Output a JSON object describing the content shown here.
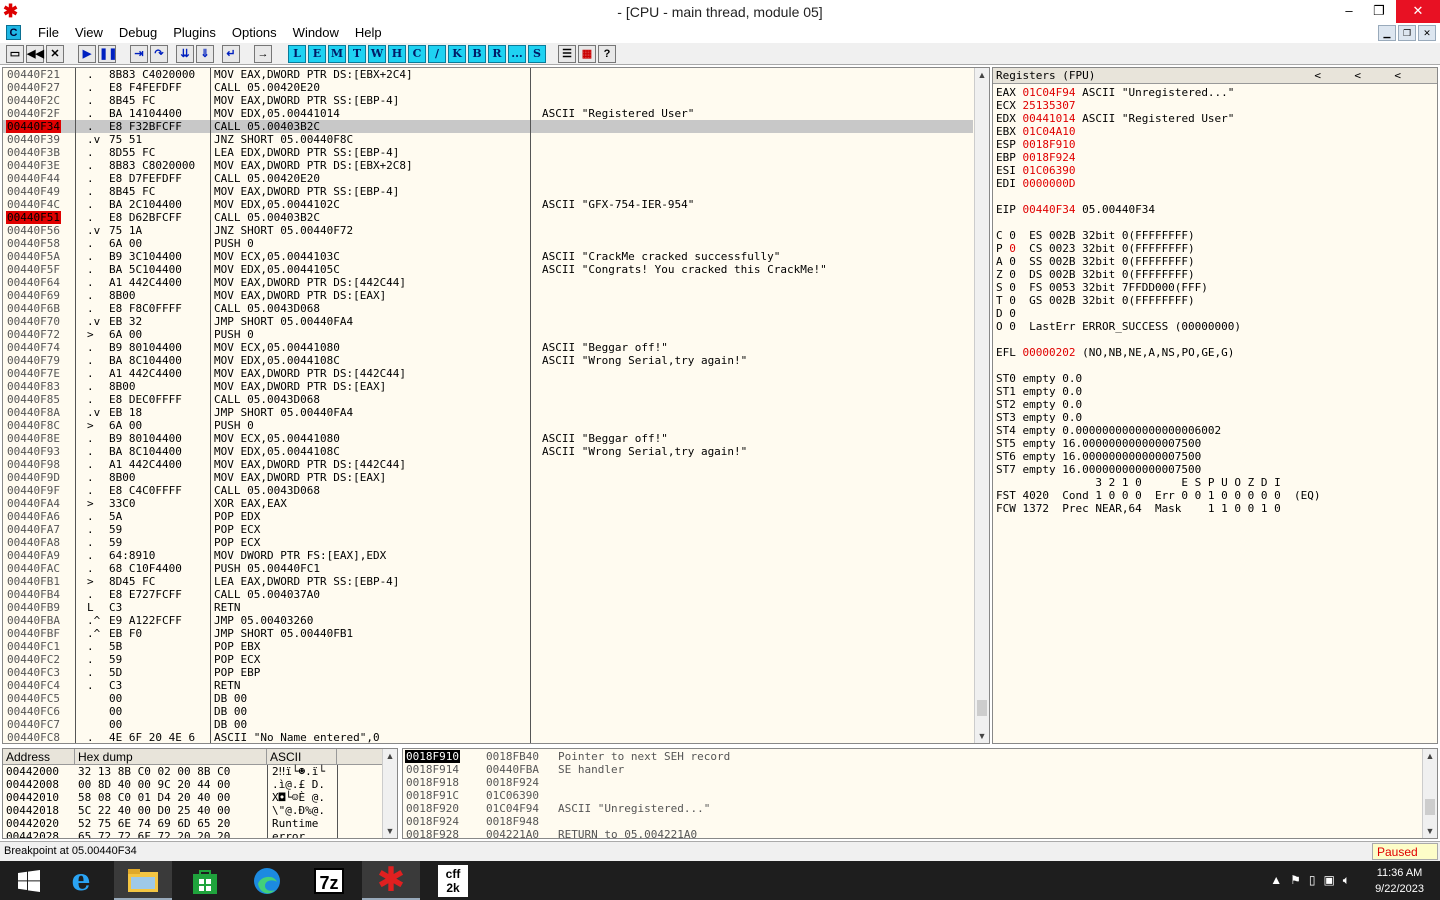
{
  "window": {
    "title": "- [CPU - main thread, module 05]",
    "minimize": "–",
    "restore": "❐",
    "close": "✕"
  },
  "menu": {
    "icon_letter": "C",
    "items": [
      "File",
      "View",
      "Debug",
      "Plugins",
      "Options",
      "Window",
      "Help"
    ]
  },
  "toolbar": {
    "letters": [
      "L",
      "E",
      "M",
      "T",
      "W",
      "H",
      "C",
      "/",
      "K",
      "B",
      "R",
      "...",
      "S"
    ]
  },
  "disasm": {
    "rows": [
      {
        "addr": "00440F21",
        "mark": ".",
        "hex": "8B83 C4020000",
        "inst": "MOV EAX,DWORD PTR DS:[EBX+2C4]",
        "cmt": ""
      },
      {
        "addr": "00440F27",
        "mark": ".",
        "hex": "E8 F4FEFDFF",
        "inst": "CALL 05.00420E20",
        "cmt": ""
      },
      {
        "addr": "00440F2C",
        "mark": ".",
        "hex": "8B45 FC",
        "inst": "MOV EAX,DWORD PTR SS:[EBP-4]",
        "cmt": ""
      },
      {
        "addr": "00440F2F",
        "mark": ".",
        "hex": "BA 14104400",
        "inst": "MOV EDX,05.00441014",
        "cmt": "ASCII \"Registered User\""
      },
      {
        "addr": "00440F34",
        "mark": ".",
        "hex": "E8 F32BFCFF",
        "inst": "CALL 05.00403B2C",
        "cmt": "",
        "bp": true,
        "sel": true
      },
      {
        "addr": "00440F39",
        "mark": ".v",
        "hex": "75 51",
        "inst": "JNZ SHORT 05.00440F8C",
        "cmt": ""
      },
      {
        "addr": "00440F3B",
        "mark": ".",
        "hex": "8D55 FC",
        "inst": "LEA EDX,DWORD PTR SS:[EBP-4]",
        "cmt": ""
      },
      {
        "addr": "00440F3E",
        "mark": ".",
        "hex": "8B83 C8020000",
        "inst": "MOV EAX,DWORD PTR DS:[EBX+2C8]",
        "cmt": ""
      },
      {
        "addr": "00440F44",
        "mark": ".",
        "hex": "E8 D7FEFDFF",
        "inst": "CALL 05.00420E20",
        "cmt": ""
      },
      {
        "addr": "00440F49",
        "mark": ".",
        "hex": "8B45 FC",
        "inst": "MOV EAX,DWORD PTR SS:[EBP-4]",
        "cmt": ""
      },
      {
        "addr": "00440F4C",
        "mark": ".",
        "hex": "BA 2C104400",
        "inst": "MOV EDX,05.0044102C",
        "cmt": "ASCII \"GFX-754-IER-954\""
      },
      {
        "addr": "00440F51",
        "mark": ".",
        "hex": "E8 D62BFCFF",
        "inst": "CALL 05.00403B2C",
        "cmt": "",
        "bp": true
      },
      {
        "addr": "00440F56",
        "mark": ".v",
        "hex": "75 1A",
        "inst": "JNZ SHORT 05.00440F72",
        "cmt": ""
      },
      {
        "addr": "00440F58",
        "mark": ".",
        "hex": "6A 00",
        "inst": "PUSH 0",
        "cmt": ""
      },
      {
        "addr": "00440F5A",
        "mark": ".",
        "hex": "B9 3C104400",
        "inst": "MOV ECX,05.0044103C",
        "cmt": "ASCII \"CrackMe cracked successfully\""
      },
      {
        "addr": "00440F5F",
        "mark": ".",
        "hex": "BA 5C104400",
        "inst": "MOV EDX,05.0044105C",
        "cmt": "ASCII \"Congrats! You cracked this CrackMe!\""
      },
      {
        "addr": "00440F64",
        "mark": ".",
        "hex": "A1 442C4400",
        "inst": "MOV EAX,DWORD PTR DS:[442C44]",
        "cmt": ""
      },
      {
        "addr": "00440F69",
        "mark": ".",
        "hex": "8B00",
        "inst": "MOV EAX,DWORD PTR DS:[EAX]",
        "cmt": ""
      },
      {
        "addr": "00440F6B",
        "mark": ".",
        "hex": "E8 F8C0FFFF",
        "inst": "CALL 05.0043D068",
        "cmt": ""
      },
      {
        "addr": "00440F70",
        "mark": ".v",
        "hex": "EB 32",
        "inst": "JMP SHORT 05.00440FA4",
        "cmt": ""
      },
      {
        "addr": "00440F72",
        "mark": ">",
        "hex": "6A 00",
        "inst": "PUSH 0",
        "cmt": ""
      },
      {
        "addr": "00440F74",
        "mark": ".",
        "hex": "B9 80104400",
        "inst": "MOV ECX,05.00441080",
        "cmt": "ASCII \"Beggar off!\""
      },
      {
        "addr": "00440F79",
        "mark": ".",
        "hex": "BA 8C104400",
        "inst": "MOV EDX,05.0044108C",
        "cmt": "ASCII \"Wrong Serial,try again!\""
      },
      {
        "addr": "00440F7E",
        "mark": ".",
        "hex": "A1 442C4400",
        "inst": "MOV EAX,DWORD PTR DS:[442C44]",
        "cmt": ""
      },
      {
        "addr": "00440F83",
        "mark": ".",
        "hex": "8B00",
        "inst": "MOV EAX,DWORD PTR DS:[EAX]",
        "cmt": ""
      },
      {
        "addr": "00440F85",
        "mark": ".",
        "hex": "E8 DEC0FFFF",
        "inst": "CALL 05.0043D068",
        "cmt": ""
      },
      {
        "addr": "00440F8A",
        "mark": ".v",
        "hex": "EB 18",
        "inst": "JMP SHORT 05.00440FA4",
        "cmt": ""
      },
      {
        "addr": "00440F8C",
        "mark": ">",
        "hex": "6A 00",
        "inst": "PUSH 0",
        "cmt": ""
      },
      {
        "addr": "00440F8E",
        "mark": ".",
        "hex": "B9 80104400",
        "inst": "MOV ECX,05.00441080",
        "cmt": "ASCII \"Beggar off!\""
      },
      {
        "addr": "00440F93",
        "mark": ".",
        "hex": "BA 8C104400",
        "inst": "MOV EDX,05.0044108C",
        "cmt": "ASCII \"Wrong Serial,try again!\""
      },
      {
        "addr": "00440F98",
        "mark": ".",
        "hex": "A1 442C4400",
        "inst": "MOV EAX,DWORD PTR DS:[442C44]",
        "cmt": ""
      },
      {
        "addr": "00440F9D",
        "mark": ".",
        "hex": "8B00",
        "inst": "MOV EAX,DWORD PTR DS:[EAX]",
        "cmt": ""
      },
      {
        "addr": "00440F9F",
        "mark": ".",
        "hex": "E8 C4C0FFFF",
        "inst": "CALL 05.0043D068",
        "cmt": ""
      },
      {
        "addr": "00440FA4",
        "mark": ">",
        "hex": "33C0",
        "inst": "XOR EAX,EAX",
        "cmt": ""
      },
      {
        "addr": "00440FA6",
        "mark": ".",
        "hex": "5A",
        "inst": "POP EDX",
        "cmt": ""
      },
      {
        "addr": "00440FA7",
        "mark": ".",
        "hex": "59",
        "inst": "POP ECX",
        "cmt": ""
      },
      {
        "addr": "00440FA8",
        "mark": ".",
        "hex": "59",
        "inst": "POP ECX",
        "cmt": ""
      },
      {
        "addr": "00440FA9",
        "mark": ".",
        "hex": "64:8910",
        "inst": "MOV DWORD PTR FS:[EAX],EDX",
        "cmt": ""
      },
      {
        "addr": "00440FAC",
        "mark": ".",
        "hex": "68 C10F4400",
        "inst": "PUSH 05.00440FC1",
        "cmt": ""
      },
      {
        "addr": "00440FB1",
        "mark": ">",
        "hex": "8D45 FC",
        "inst": "LEA EAX,DWORD PTR SS:[EBP-4]",
        "cmt": ""
      },
      {
        "addr": "00440FB4",
        "mark": ".",
        "hex": "E8 E727FCFF",
        "inst": "CALL 05.004037A0",
        "cmt": ""
      },
      {
        "addr": "00440FB9",
        "mark": "L",
        "hex": "C3",
        "inst": "RETN",
        "cmt": ""
      },
      {
        "addr": "00440FBA",
        "mark": ".^",
        "hex": "E9 A122FCFF",
        "inst": "JMP 05.00403260",
        "cmt": ""
      },
      {
        "addr": "00440FBF",
        "mark": ".^",
        "hex": "EB F0",
        "inst": "JMP SHORT 05.00440FB1",
        "cmt": ""
      },
      {
        "addr": "00440FC1",
        "mark": ".",
        "hex": "5B",
        "inst": "POP EBX",
        "cmt": ""
      },
      {
        "addr": "00440FC2",
        "mark": ".",
        "hex": "59",
        "inst": "POP ECX",
        "cmt": ""
      },
      {
        "addr": "00440FC3",
        "mark": ".",
        "hex": "5D",
        "inst": "POP EBP",
        "cmt": ""
      },
      {
        "addr": "00440FC4",
        "mark": ".",
        "hex": "C3",
        "inst": "RETN",
        "cmt": ""
      },
      {
        "addr": "00440FC5",
        "mark": "",
        "hex": "00",
        "inst": "DB 00",
        "cmt": ""
      },
      {
        "addr": "00440FC6",
        "mark": "",
        "hex": "00",
        "inst": "DB 00",
        "cmt": ""
      },
      {
        "addr": "00440FC7",
        "mark": "",
        "hex": "00",
        "inst": "DB 00",
        "cmt": ""
      },
      {
        "addr": "00440FC8",
        "mark": ".",
        "hex": "4E 6F 20 4E 6",
        "inst": "ASCII \"No Name entered\",0",
        "cmt": ""
      }
    ]
  },
  "registers": {
    "header": "Registers (FPU)",
    "lines": [
      [
        [
          "EAX ",
          ""
        ],
        [
          "01C04F94",
          "red"
        ],
        [
          " ASCII \"Unregistered...\"",
          ""
        ]
      ],
      [
        [
          "ECX ",
          ""
        ],
        [
          "25135307",
          "red"
        ]
      ],
      [
        [
          "EDX ",
          ""
        ],
        [
          "00441014",
          "red"
        ],
        [
          " ASCII \"Registered User\"",
          ""
        ]
      ],
      [
        [
          "EBX ",
          ""
        ],
        [
          "01C04A10",
          "red"
        ]
      ],
      [
        [
          "ESP ",
          ""
        ],
        [
          "0018F910",
          "red"
        ]
      ],
      [
        [
          "EBP ",
          ""
        ],
        [
          "0018F924",
          "red"
        ]
      ],
      [
        [
          "ESI ",
          ""
        ],
        [
          "01C06390",
          "red"
        ]
      ],
      [
        [
          "EDI ",
          ""
        ],
        [
          "0000000D",
          "red"
        ]
      ],
      [
        [
          " ",
          ""
        ]
      ],
      [
        [
          "EIP ",
          ""
        ],
        [
          "00440F34",
          "red"
        ],
        [
          " 05.00440F34",
          ""
        ]
      ],
      [
        [
          " ",
          ""
        ]
      ],
      [
        [
          "C 0  ES 002B 32bit 0(FFFFFFFF)",
          ""
        ]
      ],
      [
        [
          "P ",
          ""
        ],
        [
          "0",
          "red"
        ],
        [
          "  CS 0023 32bit 0(FFFFFFFF)",
          ""
        ]
      ],
      [
        [
          "A 0  SS 002B 32bit 0(FFFFFFFF)",
          ""
        ]
      ],
      [
        [
          "Z 0  DS 002B 32bit 0(FFFFFFFF)",
          ""
        ]
      ],
      [
        [
          "S 0  FS 0053 32bit 7FFDD000(FFF)",
          ""
        ]
      ],
      [
        [
          "T 0  GS 002B 32bit 0(FFFFFFFF)",
          ""
        ]
      ],
      [
        [
          "D 0",
          ""
        ]
      ],
      [
        [
          "O 0  LastErr ERROR_SUCCESS (00000000)",
          ""
        ]
      ],
      [
        [
          " ",
          ""
        ]
      ],
      [
        [
          "EFL ",
          ""
        ],
        [
          "00000202",
          "red"
        ],
        [
          " (NO,NB,NE,A,NS,PO,GE,G)",
          ""
        ]
      ],
      [
        [
          " ",
          ""
        ]
      ],
      [
        [
          "ST0 empty 0.0",
          ""
        ]
      ],
      [
        [
          "ST1 empty 0.0",
          ""
        ]
      ],
      [
        [
          "ST2 empty 0.0",
          ""
        ]
      ],
      [
        [
          "ST3 empty 0.0",
          ""
        ]
      ],
      [
        [
          "ST4 empty 0.0000000000000000006002",
          ""
        ]
      ],
      [
        [
          "ST5 empty 16.000000000000007500",
          ""
        ]
      ],
      [
        [
          "ST6 empty 16.000000000000007500",
          ""
        ]
      ],
      [
        [
          "ST7 empty 16.000000000000007500",
          ""
        ]
      ],
      [
        [
          "               3 2 1 0      E S P U O Z D I",
          ""
        ]
      ],
      [
        [
          "FST 4020  Cond 1 0 0 0  Err 0 0 1 0 0 0 0 0  (EQ)",
          ""
        ]
      ],
      [
        [
          "FCW 1372  Prec NEAR,64  Mask    1 1 0 0 1 0",
          ""
        ]
      ]
    ]
  },
  "dump": {
    "headers": [
      "Address",
      "Hex dump",
      "ASCII"
    ],
    "rows": [
      {
        "addr": "00442000",
        "hex": "32 13 8B C0 02 00 8B C0",
        "ascii": "2‼ï└☻.ï└"
      },
      {
        "addr": "00442008",
        "hex": "00 8D 40 00 9C 20 44 00",
        "ascii": ".ì@.£ D."
      },
      {
        "addr": "00442010",
        "hex": "58 08 C0 01 D4 20 40 00",
        "ascii": "X◘└☺È @."
      },
      {
        "addr": "00442018",
        "hex": "5C 22 40 00 D0 25 40 00",
        "ascii": "\\\"@.Ð%@."
      },
      {
        "addr": "00442020",
        "hex": "52 75 6E 74 69 6D 65 20",
        "ascii": "Runtime "
      },
      {
        "addr": "00442028",
        "hex": "65 72 72 6F 72 20 20 20",
        "ascii": "error   "
      }
    ]
  },
  "stack": {
    "rows": [
      {
        "addr": "0018F910",
        "val": "0018FB40",
        "cmt": "Pointer to next SEH record",
        "sel": true
      },
      {
        "addr": "0018F914",
        "val": "00440FBA",
        "cmt": "SE handler"
      },
      {
        "addr": "0018F918",
        "val": "0018F924",
        "cmt": ""
      },
      {
        "addr": "0018F91C",
        "val": "01C06390",
        "cmt": ""
      },
      {
        "addr": "0018F920",
        "val": "01C04F94",
        "cmt": "ASCII \"Unregistered...\""
      },
      {
        "addr": "0018F924",
        "val": "0018F948",
        "cmt": ""
      },
      {
        "addr": "0018F928",
        "val": "004221A0",
        "cmt": "RETURN to 05.004221A0"
      }
    ]
  },
  "status": {
    "message": "Breakpoint at 05.00440F34",
    "state": "Paused"
  },
  "taskbar": {
    "time": "11:36 AM",
    "date": "9/22/2023",
    "icons": [
      "start-icon",
      "ie-icon",
      "explorer-icon",
      "store-icon",
      "edge-icon",
      "7zip-icon",
      "ollydbg-icon",
      "cff-explorer-icon"
    ],
    "sevenzip_label": "7z",
    "cff_label": "cff 2k"
  },
  "colors": {
    "breakpoint": "#e00000",
    "panel_bg": "#fffbf0",
    "toolbar_letter_bg": "#1fd2f2",
    "paused_text": "#e00000"
  }
}
